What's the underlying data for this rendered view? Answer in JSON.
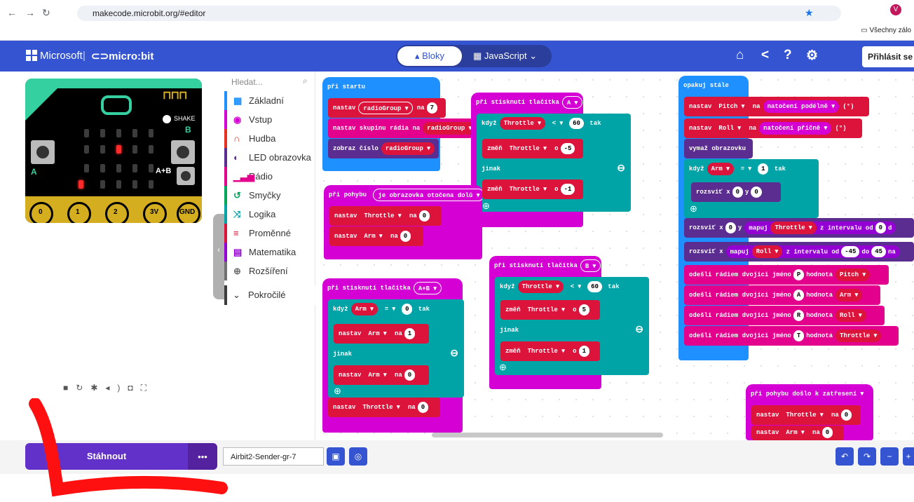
{
  "browser": {
    "url": "makecode.microbit.org/#editor",
    "bookmark_folder": "Všechny zálo"
  },
  "header": {
    "brand": "Microsoft",
    "product": "micro:bit",
    "blocks_label": "Bloky",
    "js_label": "JavaScript",
    "login_label": "Přihlásit se"
  },
  "toolbox": {
    "search_placeholder": "Hledat...",
    "categories": [
      {
        "label": "Základní",
        "color": "#1e90ff",
        "icon": "grid-icon"
      },
      {
        "label": "Vstup",
        "color": "#d400d4",
        "icon": "circle-icon"
      },
      {
        "label": "Hudba",
        "color": "#e63022",
        "icon": "headphones-icon"
      },
      {
        "label": "LED obrazovka",
        "color": "#5c2d91",
        "icon": "toggle-icon"
      },
      {
        "label": "Rádio",
        "color": "#e3008c",
        "icon": "signal-icon"
      },
      {
        "label": "Smyčky",
        "color": "#00a65a",
        "icon": "loop-icon"
      },
      {
        "label": "Logika",
        "color": "#00a4a6",
        "icon": "shuffle-icon"
      },
      {
        "label": "Proměnné",
        "color": "#dc143c",
        "icon": "lines-icon"
      },
      {
        "label": "Matematika",
        "color": "#9400d3",
        "icon": "calculator-icon"
      },
      {
        "label": "Rozšíření",
        "color": "#717171",
        "icon": "plus-icon"
      }
    ],
    "advanced": "Pokročilé"
  },
  "simulator": {
    "shake_label": "SHAKE",
    "pins": [
      "0",
      "1",
      "2",
      "3V",
      "GND"
    ],
    "button_a": "A",
    "button_b": "B",
    "button_ab": "A+B"
  },
  "colors": {
    "topbar": "#3454d1",
    "events": "#1e90ff",
    "logic": "#00a4a6",
    "variables": "#dc143c",
    "radio": "#e3008c",
    "input": "#d400d4",
    "led": "#5c2d91",
    "math": "#9400d3"
  },
  "blocks": {
    "on_start": {
      "hat": "při startu",
      "b1": "nastav",
      "var1": "radioGroup ▾",
      "na": "na",
      "v1": "7",
      "b2": "nastav skupinu rádia na",
      "var2": "radioGroup ▾",
      "b3": "zobraz číslo",
      "var3": "radioGroup ▾"
    },
    "btn_a": {
      "hat": "při stisknutí tlačítka",
      "btn": "A ▾",
      "kdyz": "když",
      "var": "Throttle ▾",
      "op": "< ▾",
      "val": "60",
      "tak": "tak",
      "zmen": "změň",
      "var2": "Throttle ▾",
      "o": "o",
      "v2": "-5",
      "jinak": "jinak",
      "v3": "-1"
    },
    "gesture": {
      "hat": "při pohybu",
      "g": "je obrazovka otočena dolů ▾",
      "b1": "nastav",
      "var1": "Throttle ▾",
      "na": "na",
      "v1": "0",
      "var2": "Arm ▾",
      "v2": "0"
    },
    "btn_ab": {
      "hat": "při stisknutí tlačítka",
      "btn": "A+B ▾",
      "kdyz": "když",
      "var": "Arm ▾",
      "op": "= ▾",
      "val": "0",
      "tak": "tak",
      "b1": "nastav",
      "var1": "Arm ▾",
      "na": "na",
      "v1": "1",
      "jinak": "jinak",
      "v2": "0",
      "var3": "Throttle ▾",
      "v3": "0"
    },
    "btn_b": {
      "hat": "při stisknutí tlačítka",
      "btn": "B ▾",
      "kdyz": "když",
      "var": "Throttle ▾",
      "op": "< ▾",
      "val": "60",
      "tak": "tak",
      "zmen": "změň",
      "var2": "Throttle ▾",
      "o": "o",
      "v2": "5",
      "jinak": "jinak",
      "v3": "1"
    },
    "forever": {
      "hat": "opakuj stále",
      "b1": "nastav",
      "var1": "Pitch ▾",
      "na": "na",
      "s1": "natočení podélně ▾",
      "u": "(°)",
      "var2": "Roll ▾",
      "s2": "natočení příčně ▾",
      "clear": "vymaž obrazovku",
      "kdyz": "když",
      "var3": "Arm ▾",
      "op": "= ▾",
      "val": "1",
      "tak": "tak",
      "plot": "rozsviť x",
      "y": "y",
      "z": "0",
      "plotx": "rozsviť x",
      "mapuj": "mapuj",
      "mvar": "Throttle ▾",
      "zint": "z intervalu od",
      "mvar2": "Roll ▾",
      "do": "do",
      "m45": "-45",
      "p45": "45",
      "send": "odešli rádiem dvojici jméno",
      "hod": "hodnota",
      "P": "P",
      "A": "A",
      "R": "R",
      "T": "T",
      "sv1": "Pitch ▾",
      "sv2": "Arm ▾",
      "sv3": "Roll ▾",
      "sv4": "Throttle ▾",
      "na2": "na",
      "d": "d"
    },
    "shake": {
      "hat": "při pohybu došlo k zatřesení ▾",
      "b1": "nastav",
      "var1": "Throttle ▾",
      "na": "na",
      "v1": "0",
      "var2": "Arm ▾",
      "v2": "0"
    }
  },
  "footer": {
    "download": "Stáhnout",
    "more": "•••",
    "project_name": "Airbit2-Sender-gr-7"
  }
}
